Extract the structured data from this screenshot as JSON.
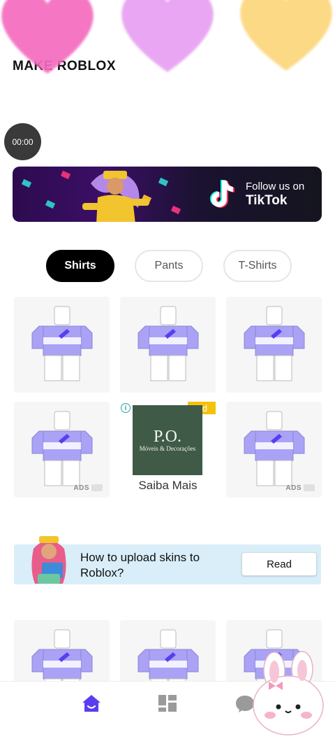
{
  "app": {
    "title": "MAKE ROBLOX"
  },
  "recording": {
    "timer": "00:00"
  },
  "banner": {
    "follow_text": "Follow us on",
    "brand": "TikTok"
  },
  "tabs": [
    {
      "label": "Shirts",
      "active": true
    },
    {
      "label": "Pants",
      "active": false
    },
    {
      "label": "T-Shirts",
      "active": false
    }
  ],
  "grid": {
    "ads_label": "ADS",
    "ad": {
      "badge": "Ad",
      "brand_line1": "P.O.",
      "brand_line2": "Móveis & Decorações",
      "cta": "Saiba Mais"
    }
  },
  "help": {
    "question": "How to upload skins to Roblox?",
    "button": "Read"
  },
  "nav": [
    "home-icon",
    "dashboard-icon",
    "chat-icon"
  ],
  "colors": {
    "accent": "#5b3df0",
    "shirt": "#a9a2f5",
    "ad_badge": "#f4c20d",
    "ad_bg": "#3f5a47",
    "help_bg": "#d9eef8"
  }
}
